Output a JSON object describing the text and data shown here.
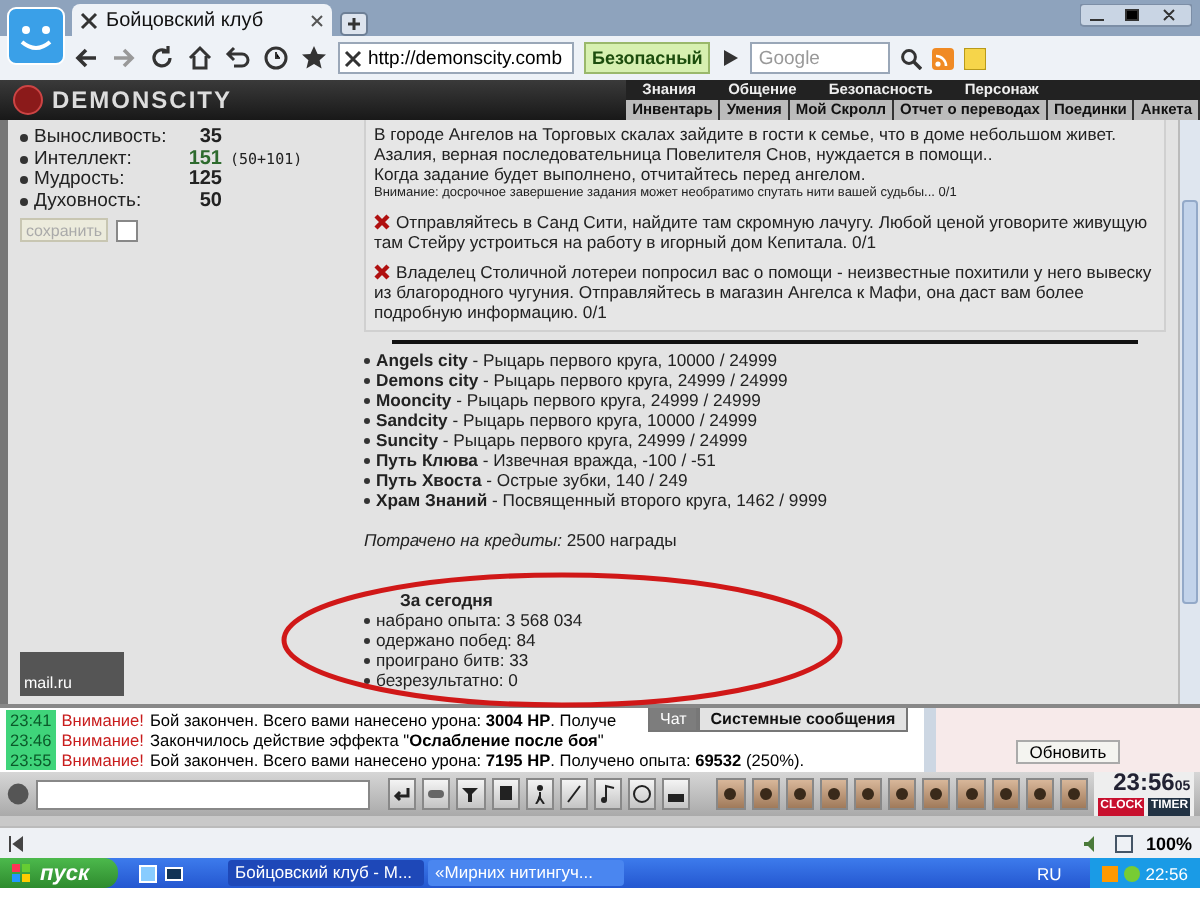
{
  "browser": {
    "tab": {
      "title": "Бойцовский клуб"
    },
    "url": "http://demonscity.comb",
    "security": "Безопасный",
    "search": {
      "placeholder": "Google"
    }
  },
  "site": {
    "logo": "DEMONSCITY",
    "top_menu": [
      "Знания",
      "Общение",
      "Безопасность",
      "Персонаж"
    ],
    "sub_menu": [
      "Инвентарь",
      "Умения",
      "Мой Скролл",
      "Отчет о переводах",
      "Поединки",
      "Анкета"
    ]
  },
  "stats": {
    "items": [
      {
        "label": "Выносливость:",
        "value": "35",
        "color": "#222222"
      },
      {
        "label": "Интеллект:",
        "value": "151",
        "bonus": "(50+101)",
        "color": "#2e6b2e"
      },
      {
        "label": "Мудрость:",
        "value": "125",
        "color": "#222222"
      },
      {
        "label": "Духовность:",
        "value": "50",
        "color": "#222222"
      }
    ],
    "save": {
      "label": "сохранить",
      "disabled": true
    },
    "checkbox": {
      "checked": false
    },
    "counter": {
      "label": "mail.ru"
    }
  },
  "quests": [
    {
      "failed": false,
      "lines": [
        "В городе Ангелов на Торговых скалах зайдите в гости к семье, что в доме небольшом живет.",
        "Азалия, верная последовательница Повелителя Снов, нуждается в помощи..",
        "Когда задание будет выполнено, отчитайтесь перед ангелом."
      ],
      "note": "Внимание: досрочное завершение задания может необратимо спутать нити вашей судьбы... 0/1"
    },
    {
      "failed": true,
      "lines": [
        "Отправляйтесь в Санд Сити, найдите там скромную лачугу. Любой ценой уговорите живущую там Стейру устроиться на работу в игорный дом Кепитала. 0/1"
      ]
    },
    {
      "failed": true,
      "lines": [
        "Владелец Столичной лотереи попросил вас о помощи - неизвестные похитили у него вывеску из благородного чугуния. Отправляйтесь в магазин Ангелса к Мафи, она даст вам более подробную информацию. 0/1"
      ]
    }
  ],
  "reputation": [
    "**Angels city** - Рыцарь первого круга, 10000 / 24999",
    "**Demons city** - Рыцарь первого круга, 24999 / 24999",
    "**Mooncity** - Рыцарь первого круга, 24999 / 24999",
    "**Sandcity** - Рыцарь первого круга, 10000 / 24999",
    "**Suncity** - Рыцарь первого круга, 24999 / 24999",
    "**Путь Клюва** - Извечная вражда, -100 / -51",
    "**Путь Хвоста** - Острые зубки, 140 / 249",
    "**Храм Знаний** - Посвященный второго круга, 1462 / 9999"
  ],
  "credits": "*Потрачено на кредиты:* 2500 награды",
  "today": {
    "title": "За сегодня",
    "items": [
      "набрано опыта: 3 568 034",
      "одержано побед: 84",
      "проиграно битв: 33",
      "безрезультатно: 0"
    ]
  },
  "chat": {
    "messages": [
      {
        "time": "23:41",
        "alert": "Внимание!",
        "text": "Бой закончен. Всего вами нанесено урона: **3004 HP**. Получе"
      },
      {
        "time": "23:46",
        "alert": "Внимание!",
        "text": "Закончилось действие эффекта \"**Ослабление после боя**\""
      },
      {
        "time": "23:55",
        "alert": "Внимание!",
        "text": "Бой закончен. Всего вами нанесено урона: **7195 HP**. Получено опыта: **69532** (250%)."
      }
    ],
    "tabs": [
      {
        "label": "Чат",
        "selected": false
      },
      {
        "label": "Системные сообщения",
        "selected": true
      }
    ],
    "refresh": "Обновить"
  },
  "toolbar": {
    "clock": "23:56",
    "seconds": "05",
    "clock_label": "CLOCK",
    "timer_label": "TIMER"
  },
  "status_bar": {
    "zoom": "100%"
  },
  "taskbar": {
    "start": "пуск",
    "tasks": [
      {
        "label": "Бойцовский клуб - М...",
        "selected": true
      },
      {
        "label": "«Мирних нитингуч...",
        "selected": false
      }
    ],
    "language": "RU",
    "time": "22:56"
  }
}
